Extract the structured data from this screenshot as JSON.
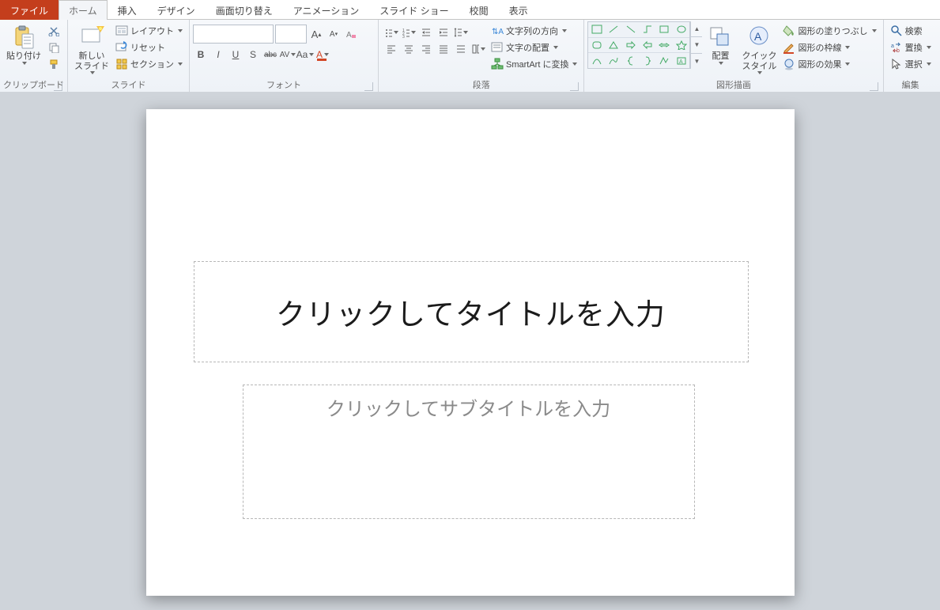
{
  "tabs": {
    "file": "ファイル",
    "home": "ホーム",
    "insert": "挿入",
    "design": "デザイン",
    "transitions": "画面切り替え",
    "animations": "アニメーション",
    "slideshow": "スライド ショー",
    "review": "校閲",
    "view": "表示"
  },
  "groups": {
    "clipboard": {
      "title": "クリップボード",
      "paste": "貼り付け"
    },
    "slides": {
      "title": "スライド",
      "newslide": "新しい\nスライド",
      "layout": "レイアウト",
      "reset": "リセット",
      "section": "セクション"
    },
    "font": {
      "title": "フォント"
    },
    "paragraph": {
      "title": "段落",
      "textdir": "文字列の方向",
      "align": "文字の配置",
      "smartart": "SmartArt に変換"
    },
    "drawing": {
      "title": "図形描画",
      "arrange": "配置",
      "quickstyles": "クイック\nスタイル",
      "fill": "図形の塗りつぶし",
      "outline": "図形の枠線",
      "effects": "図形の効果"
    },
    "editing": {
      "title": "編集",
      "find": "検索",
      "replace": "置換",
      "select": "選択"
    }
  },
  "slide": {
    "title_placeholder": "クリックしてタイトルを入力",
    "subtitle_placeholder": "クリックしてサブタイトルを入力"
  },
  "font_buttons": {
    "B": "B",
    "I": "I",
    "U": "U",
    "S": "S",
    "abc": "abc",
    "AV": "AV",
    "Aa": "Aa",
    "A": "A"
  },
  "fontsize_icons": {
    "grow": "A",
    "shrink": "A"
  }
}
